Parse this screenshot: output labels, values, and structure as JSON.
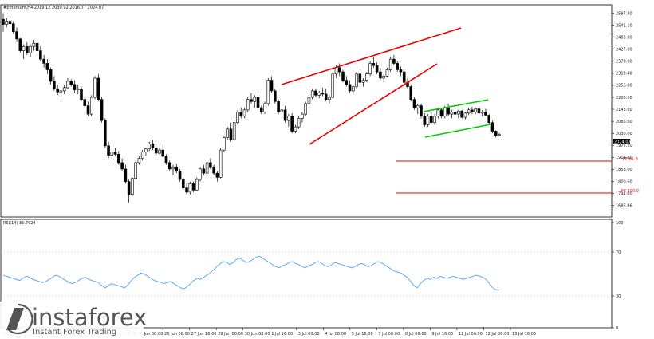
{
  "chart_title": "#Ethereum,H4 2019.12 2030.92 2016.77 2024.07",
  "rsi_title": "RSI(14) 35.7024",
  "current_price": "2024.07",
  "watermark": {
    "brand": "instaforex",
    "tagline": "Instant Forex Trading"
  },
  "colors": {
    "bull_body": "#ffffff",
    "bear_body": "#000000",
    "channel": "#ee0000",
    "flag": "#00cc00",
    "fib_line": "#ee0000",
    "rsi_line": "#4aa3ff",
    "price_tag": "#000000"
  },
  "chart_data": [
    {
      "type": "candlestick",
      "title": "#Ethereum,H4 2019.12 2030.92 2016.77 2024.07",
      "ylim": [
        1686.86,
        2541
      ],
      "y_ticks": [
        "2597.80",
        "2541.10",
        "2483.00",
        "2427.00",
        "2370.00",
        "2313.40",
        "2256.00",
        "2200.00",
        "2143.00",
        "2086.00",
        "2030.00",
        "1972.20",
        "1914.80",
        "1858.00",
        "1800.60",
        "1744.00",
        "1686.86"
      ],
      "x_ticks": [
        "18 Jun 2021",
        "19 Jun 16:00",
        "21 Jun 00:00",
        "22 Jun 08:00",
        "23 Jun 16:00",
        "25 Jun 00:00",
        "26 Jun 08:00",
        "27 Jun 16:00",
        "29 Jun 00:00",
        "30 Jun 08:00",
        "1 Jul 16:00",
        "3 Jul 00:00",
        "4 Jul 08:00",
        "5 Jul 16:00",
        "7 Jul 00:00",
        "8 Jul 08:00",
        "9 Jul 16:00",
        "11 Jul 00:00",
        "12 Jul 08:00",
        "13 Jul 16:00"
      ],
      "candles": [
        [
          2569,
          2597,
          2510,
          2545
        ],
        [
          2545,
          2575,
          2530,
          2560
        ],
        [
          2560,
          2585,
          2540,
          2548
        ],
        [
          2548,
          2560,
          2500,
          2510
        ],
        [
          2510,
          2530,
          2460,
          2475
        ],
        [
          2475,
          2480,
          2410,
          2420
        ],
        [
          2420,
          2450,
          2380,
          2440
        ],
        [
          2440,
          2460,
          2400,
          2410
        ],
        [
          2410,
          2450,
          2390,
          2440
        ],
        [
          2440,
          2470,
          2420,
          2455
        ],
        [
          2455,
          2470,
          2410,
          2420
        ],
        [
          2420,
          2440,
          2370,
          2380
        ],
        [
          2380,
          2400,
          2340,
          2360
        ],
        [
          2360,
          2380,
          2310,
          2330
        ],
        [
          2330,
          2340,
          2260,
          2275
        ],
        [
          2275,
          2300,
          2230,
          2240
        ],
        [
          2240,
          2260,
          2210,
          2225
        ],
        [
          2225,
          2250,
          2205,
          2230
        ],
        [
          2230,
          2260,
          2215,
          2245
        ],
        [
          2245,
          2290,
          2240,
          2275
        ],
        [
          2275,
          2285,
          2250,
          2260
        ],
        [
          2260,
          2280,
          2220,
          2235
        ],
        [
          2235,
          2260,
          2215,
          2240
        ],
        [
          2240,
          2250,
          2180,
          2190
        ],
        [
          2190,
          2200,
          2150,
          2160
        ],
        [
          2160,
          2180,
          2110,
          2120
        ],
        [
          2120,
          2210,
          2110,
          2200
        ],
        [
          2200,
          2300,
          2190,
          2290
        ],
        [
          2290,
          2310,
          2180,
          2190
        ],
        [
          2190,
          2200,
          2080,
          2090
        ],
        [
          2090,
          2100,
          1960,
          1970
        ],
        [
          1970,
          1990,
          1910,
          1925
        ],
        [
          1925,
          1950,
          1900,
          1940
        ],
        [
          1940,
          1960,
          1920,
          1930
        ],
        [
          1930,
          1945,
          1880,
          1890
        ],
        [
          1890,
          1910,
          1850,
          1860
        ],
        [
          1860,
          1880,
          1790,
          1800
        ],
        [
          1800,
          1810,
          1700,
          1740
        ],
        [
          1740,
          1820,
          1730,
          1815
        ],
        [
          1815,
          1900,
          1810,
          1890
        ],
        [
          1890,
          1920,
          1880,
          1910
        ],
        [
          1910,
          1950,
          1900,
          1940
        ],
        [
          1940,
          1960,
          1920,
          1955
        ],
        [
          1955,
          1990,
          1945,
          1980
        ],
        [
          1980,
          2000,
          1950,
          1960
        ],
        [
          1960,
          1980,
          1920,
          1935
        ],
        [
          1935,
          1960,
          1930,
          1950
        ],
        [
          1950,
          1975,
          1910,
          1920
        ],
        [
          1920,
          1930,
          1880,
          1890
        ],
        [
          1890,
          1900,
          1850,
          1860
        ],
        [
          1860,
          1880,
          1830,
          1870
        ],
        [
          1870,
          1885,
          1840,
          1850
        ],
        [
          1850,
          1860,
          1800,
          1810
        ],
        [
          1810,
          1820,
          1760,
          1770
        ],
        [
          1770,
          1790,
          1740,
          1750
        ],
        [
          1750,
          1800,
          1740,
          1790
        ],
        [
          1790,
          1800,
          1750,
          1760
        ],
        [
          1760,
          1820,
          1755,
          1810
        ],
        [
          1810,
          1870,
          1800,
          1860
        ],
        [
          1860,
          1880,
          1830,
          1840
        ],
        [
          1840,
          1900,
          1835,
          1890
        ],
        [
          1890,
          1910,
          1860,
          1870
        ],
        [
          1870,
          1880,
          1830,
          1840
        ],
        [
          1840,
          1850,
          1800,
          1820
        ],
        [
          1820,
          1960,
          1815,
          1950
        ],
        [
          1950,
          2020,
          1940,
          2010
        ],
        [
          2010,
          2060,
          2000,
          2050
        ],
        [
          2050,
          2080,
          1990,
          2000
        ],
        [
          2000,
          2090,
          1995,
          2080
        ],
        [
          2080,
          2140,
          2070,
          2130
        ],
        [
          2130,
          2150,
          2100,
          2110
        ],
        [
          2110,
          2150,
          2100,
          2140
        ],
        [
          2140,
          2200,
          2130,
          2190
        ],
        [
          2190,
          2220,
          2170,
          2180
        ],
        [
          2180,
          2210,
          2150,
          2200
        ],
        [
          2200,
          2210,
          2140,
          2150
        ],
        [
          2150,
          2160,
          2120,
          2130
        ],
        [
          2130,
          2180,
          2120,
          2170
        ],
        [
          2170,
          2290,
          2160,
          2280
        ],
        [
          2280,
          2300,
          2220,
          2230
        ],
        [
          2230,
          2240,
          2170,
          2180
        ],
        [
          2180,
          2190,
          2120,
          2130
        ],
        [
          2130,
          2150,
          2100,
          2140
        ],
        [
          2140,
          2160,
          2080,
          2090
        ],
        [
          2090,
          2120,
          2060,
          2110
        ],
        [
          2110,
          2125,
          2030,
          2040
        ],
        [
          2040,
          2070,
          2030,
          2060
        ],
        [
          2060,
          2110,
          2050,
          2100
        ],
        [
          2100,
          2130,
          2080,
          2120
        ],
        [
          2120,
          2180,
          2110,
          2170
        ],
        [
          2170,
          2210,
          2160,
          2200
        ],
        [
          2200,
          2240,
          2190,
          2230
        ],
        [
          2230,
          2240,
          2200,
          2210
        ],
        [
          2210,
          2230,
          2195,
          2220
        ],
        [
          2220,
          2245,
          2205,
          2215
        ],
        [
          2215,
          2240,
          2180,
          2190
        ],
        [
          2190,
          2210,
          2170,
          2200
        ],
        [
          2200,
          2320,
          2195,
          2310
        ],
        [
          2310,
          2350,
          2290,
          2340
        ],
        [
          2340,
          2360,
          2300,
          2320
        ],
        [
          2320,
          2330,
          2270,
          2280
        ],
        [
          2280,
          2300,
          2250,
          2260
        ],
        [
          2260,
          2280,
          2220,
          2230
        ],
        [
          2230,
          2260,
          2210,
          2250
        ],
        [
          2250,
          2320,
          2240,
          2310
        ],
        [
          2310,
          2330,
          2260,
          2270
        ],
        [
          2270,
          2290,
          2250,
          2280
        ],
        [
          2280,
          2320,
          2270,
          2310
        ],
        [
          2310,
          2370,
          2300,
          2360
        ],
        [
          2360,
          2390,
          2340,
          2350
        ],
        [
          2350,
          2365,
          2310,
          2320
        ],
        [
          2320,
          2340,
          2280,
          2290
        ],
        [
          2290,
          2310,
          2270,
          2300
        ],
        [
          2300,
          2340,
          2295,
          2330
        ],
        [
          2330,
          2390,
          2320,
          2380
        ],
        [
          2380,
          2400,
          2350,
          2360
        ],
        [
          2360,
          2370,
          2320,
          2330
        ],
        [
          2330,
          2345,
          2300,
          2320
        ],
        [
          2320,
          2330,
          2260,
          2270
        ],
        [
          2270,
          2290,
          2240,
          2250
        ],
        [
          2250,
          2260,
          2180,
          2190
        ],
        [
          2190,
          2200,
          2140,
          2150
        ],
        [
          2150,
          2170,
          2120,
          2160
        ],
        [
          2160,
          2170,
          2100,
          2110
        ],
        [
          2110,
          2125,
          2060,
          2070
        ],
        [
          2070,
          2120,
          2060,
          2110
        ],
        [
          2110,
          2130,
          2070,
          2080
        ],
        [
          2080,
          2120,
          2070,
          2110
        ],
        [
          2110,
          2150,
          2100,
          2140
        ],
        [
          2140,
          2150,
          2100,
          2110
        ],
        [
          2110,
          2160,
          2100,
          2150
        ],
        [
          2150,
          2170,
          2110,
          2120
        ],
        [
          2120,
          2140,
          2100,
          2130
        ],
        [
          2130,
          2150,
          2110,
          2120
        ],
        [
          2120,
          2140,
          2100,
          2135
        ],
        [
          2135,
          2140,
          2100,
          2105
        ],
        [
          2105,
          2130,
          2095,
          2125
        ],
        [
          2125,
          2150,
          2115,
          2140
        ],
        [
          2140,
          2155,
          2120,
          2130
        ],
        [
          2130,
          2150,
          2120,
          2145
        ],
        [
          2145,
          2160,
          2120,
          2125
        ],
        [
          2125,
          2140,
          2110,
          2130
        ],
        [
          2130,
          2145,
          2110,
          2115
        ],
        [
          2115,
          2120,
          2070,
          2080
        ],
        [
          2080,
          2090,
          2030,
          2040
        ],
        [
          2040,
          2045,
          2010,
          2020
        ],
        [
          2020,
          2031,
          2017,
          2024
        ]
      ],
      "fib_levels": [
        {
          "label": "FE 61.8",
          "price": 1950
        },
        {
          "label": "FE 100.0",
          "price": 1790
        }
      ]
    },
    {
      "type": "line",
      "title": "RSI(14) 35.7024",
      "ylim": [
        0,
        100
      ],
      "y_ticks": [
        "100",
        "70",
        "30",
        "0"
      ],
      "values": [
        50,
        49,
        48,
        47,
        46,
        45,
        47,
        49,
        48,
        46,
        45,
        44,
        43,
        44,
        46,
        48,
        50,
        49,
        47,
        45,
        43,
        42,
        43,
        45,
        47,
        48,
        46,
        45,
        44,
        43,
        40,
        38,
        40,
        42,
        41,
        40,
        39,
        38,
        41,
        45,
        48,
        50,
        52,
        51,
        49,
        47,
        45,
        44,
        43,
        42,
        43,
        44,
        42,
        40,
        38,
        37,
        39,
        42,
        45,
        47,
        46,
        48,
        50,
        52,
        55,
        58,
        61,
        63,
        62,
        60,
        62,
        65,
        66,
        64,
        62,
        63,
        65,
        67,
        68,
        66,
        64,
        62,
        60,
        58,
        57,
        59,
        60,
        62,
        63,
        61,
        60,
        58,
        57,
        59,
        60,
        62,
        63,
        61,
        59,
        58,
        60,
        62,
        61,
        60,
        59,
        58,
        57,
        58,
        60,
        61,
        60,
        58,
        59,
        61,
        63,
        62,
        60,
        58,
        56,
        54,
        53,
        52,
        50,
        48,
        44,
        40,
        38,
        42,
        45,
        47,
        46,
        48,
        47,
        49,
        48,
        47,
        48,
        49,
        48,
        47,
        46,
        47,
        48,
        49,
        50,
        49,
        48,
        46,
        42,
        38,
        36,
        35.7
      ]
    }
  ]
}
